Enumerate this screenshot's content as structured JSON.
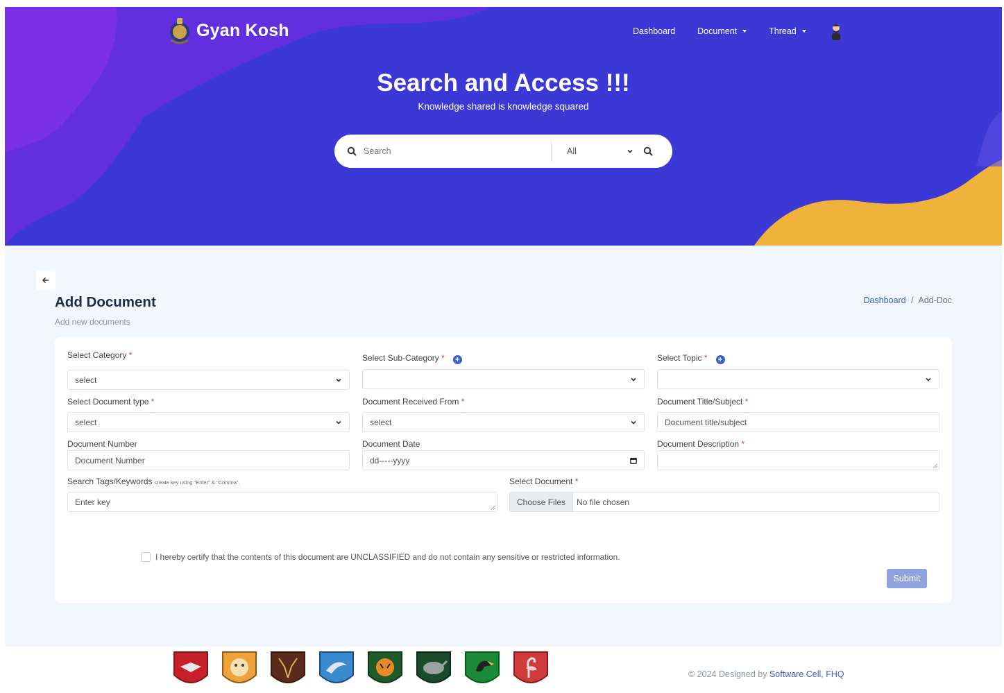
{
  "brand": {
    "name": "Gyan Kosh"
  },
  "nav": {
    "dashboard": "Dashboard",
    "document": "Document",
    "thread": "Thread"
  },
  "hero": {
    "title": "Search and Access !!!",
    "subtitle": "Knowledge shared is knowledge squared"
  },
  "search": {
    "placeholder": "Search",
    "filter_value": "All"
  },
  "page": {
    "title": "Add Document",
    "subtitle": "Add new documents"
  },
  "breadcrumb": {
    "home": "Dashboard",
    "separator": "/",
    "current": "Add-Doc"
  },
  "form": {
    "category": {
      "label": "Select Category",
      "value": "select"
    },
    "subcategory": {
      "label": "Select Sub-Category",
      "value": ""
    },
    "topic": {
      "label": "Select Topic",
      "value": ""
    },
    "doc_type": {
      "label": "Select Document type",
      "value": "select"
    },
    "received_from": {
      "label": "Document Received From",
      "value": "select"
    },
    "title": {
      "label": "Document Title/Subject",
      "placeholder": "Document title/subject"
    },
    "number": {
      "label": "Document Number",
      "placeholder": "Document Number"
    },
    "date": {
      "label": "Document Date",
      "placeholder": "dd-----yyyy"
    },
    "description": {
      "label": "Document Description",
      "placeholder": ""
    },
    "tags": {
      "label": "Search Tags/Keywords",
      "hint": "create key using \"Enter\" & \"Comma\".",
      "placeholder": "Enter key"
    },
    "file": {
      "label": "Select Document",
      "button": "Choose Files",
      "status": "No file chosen"
    },
    "required_mark": "*",
    "certify": "I hereby certify that the contents of this document are UNCLASSIFIED and do not contain any sensitive or restricted information.",
    "submit": "Submit"
  },
  "footer": {
    "copy_prefix": "© 2024 Designed by",
    "copy_link": "Software Cell, FHQ"
  },
  "colors": {
    "hero": "#3b38d6",
    "accent": "#3b5fc8",
    "wave": "#efb23a",
    "submit": "#8fa3e0"
  }
}
